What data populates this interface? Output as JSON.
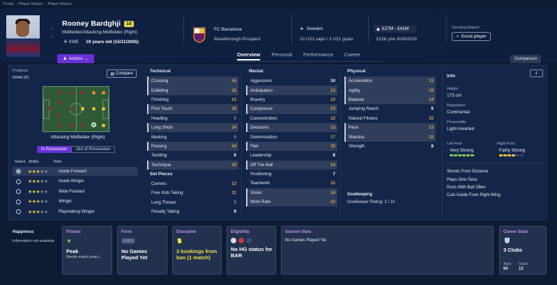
{
  "breadcrumb": [
    "Portal",
    "Player Report",
    "Player Report"
  ],
  "player": {
    "name": "Rooney Bardghji",
    "number": "10",
    "position": "Midfielder/Attacking Midfielder (Right)",
    "nationality_code": "SWE",
    "age": "19 years old (15/11/2005)"
  },
  "header": {
    "actions_label": "Actions",
    "club": "FC Barcelona",
    "club_status": "Breakthrough Prospect",
    "country": "Sweden",
    "caps": "10 U21 caps / 2 U21 goals",
    "value": "£27M - £41M",
    "wage": "£15K p/w 30/6/2029",
    "scout_label": "Scouting Report",
    "scout_button": "Scout player",
    "comparison_button": "Comparison"
  },
  "tabs": [
    "Overview",
    "Personal",
    "Performance",
    "Career"
  ],
  "positions": {
    "label": "Positions",
    "code": "M/AM (R)",
    "compare_button": "Compare",
    "selected_position": "Attacking Midfielder (Right)",
    "toggle_on": "In Possession",
    "toggle_off": "Out of Possession",
    "headers": [
      "Select",
      "Ability",
      "Role"
    ],
    "roles": [
      {
        "name": "Inside Forward",
        "stars": 3,
        "selected": true
      },
      {
        "name": "Inside Winger",
        "stars": 3,
        "selected": false
      },
      {
        "name": "Wide Forward",
        "stars": 3,
        "selected": false
      },
      {
        "name": "Winger",
        "stars": 3,
        "selected": false
      },
      {
        "name": "Playmaking Winger",
        "stars": 3,
        "selected": false
      }
    ]
  },
  "technical": {
    "title": "Technical",
    "rows": [
      {
        "name": "Crossing",
        "value": "14",
        "hl": true,
        "c": "o"
      },
      {
        "name": "Dribbling",
        "value": "15",
        "hl": true,
        "c": "o"
      },
      {
        "name": "Finishing",
        "value": "13",
        "hl": false,
        "c": "o"
      },
      {
        "name": "First Touch",
        "value": "15",
        "hl": true,
        "c": "o"
      },
      {
        "name": "Heading",
        "value": "5",
        "hl": false,
        "c": "gy"
      },
      {
        "name": "Long Shots",
        "value": "14",
        "hl": true,
        "c": "o"
      },
      {
        "name": "Marking",
        "value": "5",
        "hl": false,
        "c": "gy"
      },
      {
        "name": "Passing",
        "value": "14",
        "hl": true,
        "c": "o"
      },
      {
        "name": "Tackling",
        "value": "6",
        "hl": false,
        "c": "w"
      },
      {
        "name": "Technique",
        "value": "15",
        "hl": true,
        "c": "o"
      }
    ]
  },
  "setpieces": {
    "title": "Set Pieces",
    "rows": [
      {
        "name": "Corners",
        "value": "13",
        "hl": false,
        "c": "o"
      },
      {
        "name": "Free Kick Taking",
        "value": "11",
        "hl": false,
        "c": "o"
      },
      {
        "name": "Long Throws",
        "value": "5",
        "hl": false,
        "c": "gy"
      },
      {
        "name": "Penalty Taking",
        "value": "9",
        "hl": false,
        "c": "w"
      }
    ]
  },
  "mental": {
    "title": "Mental",
    "rows": [
      {
        "name": "Aggression",
        "value": "10",
        "hl": false,
        "c": "w"
      },
      {
        "name": "Anticipation",
        "value": "13",
        "hl": true,
        "c": "o"
      },
      {
        "name": "Bravery",
        "value": "13",
        "hl": false,
        "c": "o"
      },
      {
        "name": "Composure",
        "value": "13",
        "hl": true,
        "c": "o"
      },
      {
        "name": "Concentration",
        "value": "12",
        "hl": false,
        "c": "o"
      },
      {
        "name": "Decisions",
        "value": "13",
        "hl": true,
        "c": "o"
      },
      {
        "name": "Determination",
        "value": "17",
        "hl": false,
        "c": "g"
      },
      {
        "name": "Flair",
        "value": "15",
        "hl": true,
        "c": "o"
      },
      {
        "name": "Leadership",
        "value": "8",
        "hl": false,
        "c": "w"
      },
      {
        "name": "Off The Ball",
        "value": "14",
        "hl": true,
        "c": "o"
      },
      {
        "name": "Positioning",
        "value": "7",
        "hl": false,
        "c": "w"
      },
      {
        "name": "Teamwork",
        "value": "12",
        "hl": false,
        "c": "o"
      },
      {
        "name": "Vision",
        "value": "14",
        "hl": true,
        "c": "o"
      },
      {
        "name": "Work Rate",
        "value": "12",
        "hl": true,
        "c": "o"
      }
    ]
  },
  "physical": {
    "title": "Physical",
    "rows": [
      {
        "name": "Acceleration",
        "value": "13",
        "hl": true,
        "c": "o"
      },
      {
        "name": "Agility",
        "value": "15",
        "hl": true,
        "c": "o"
      },
      {
        "name": "Balance",
        "value": "14",
        "hl": true,
        "c": "o"
      },
      {
        "name": "Jumping Reach",
        "value": "6",
        "hl": false,
        "c": "w"
      },
      {
        "name": "Natural Fitness",
        "value": "15",
        "hl": false,
        "c": "o"
      },
      {
        "name": "Pace",
        "value": "13",
        "hl": true,
        "c": "o"
      },
      {
        "name": "Stamina",
        "value": "12",
        "hl": true,
        "c": "o"
      },
      {
        "name": "Strength",
        "value": "8",
        "hl": false,
        "c": "w"
      }
    ]
  },
  "goalkeeping": {
    "title": "Goalkeeping",
    "rating": "Goalkeeper Rating: 2 / 10"
  },
  "info": {
    "title": "Info",
    "height_label": "Height",
    "height": "173 cm",
    "reputation_label": "Reputation",
    "reputation": "Continental",
    "personality_label": "Personality",
    "personality": "Light-Hearted",
    "left_foot_label": "Left Foot",
    "left_foot": "Very Strong",
    "right_foot_label": "Right Foot",
    "right_foot": "Fairly Strong",
    "traits": [
      "Shoots From Distance",
      "Plays One-Twos",
      "Runs With Ball Often",
      "Cuts Inside From Right Wing"
    ]
  },
  "cards": {
    "happiness": {
      "title": "Happiness",
      "text": "Information not available"
    },
    "fitness": {
      "title": "Fitness",
      "status": "Peak",
      "sub": "Needs match pract..."
    },
    "form": {
      "title": "Form",
      "badge": "-",
      "text": "No Games Played Yet"
    },
    "discipline": {
      "title": "Discipline",
      "text": "3 bookings from ban (1 match)"
    },
    "eligibility": {
      "title": "Eligibility",
      "text": "No HG status for BAR"
    },
    "season": {
      "title": "Season Stats",
      "text": "No Games Played Yet"
    },
    "career": {
      "title": "Career Stats",
      "clubs": "3 Clubs",
      "apps_label": "Apps",
      "apps": "60",
      "goals_label": "Goals",
      "goals": "12"
    }
  },
  "colors": {
    "accent": "#6b31d8",
    "good": "#e8a93a",
    "great": "#86c654",
    "card_title": "#c78ff0"
  }
}
